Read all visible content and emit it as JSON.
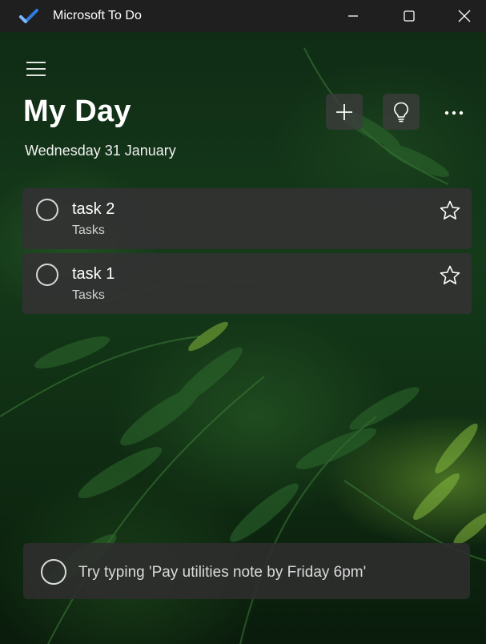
{
  "window": {
    "title": "Microsoft To Do",
    "controls": [
      "minimize-icon",
      "maximize-icon",
      "close-icon"
    ]
  },
  "header": {
    "title": "My Day",
    "date": "Wednesday 31 January",
    "buttons": [
      "add-icon",
      "lightbulb-icon",
      "more-icon"
    ]
  },
  "tasks": [
    {
      "title": "task 2",
      "list": "Tasks",
      "completed": false,
      "important": false
    },
    {
      "title": "task 1",
      "list": "Tasks",
      "completed": false,
      "important": false
    }
  ],
  "add_task": {
    "placeholder": "Try typing 'Pay utilities note by Friday 6pm'"
  },
  "colors": {
    "titlebar": "#1f1f1f",
    "card": "#323232",
    "text": "#ffffff",
    "accent_blue": "#2f7de1"
  }
}
